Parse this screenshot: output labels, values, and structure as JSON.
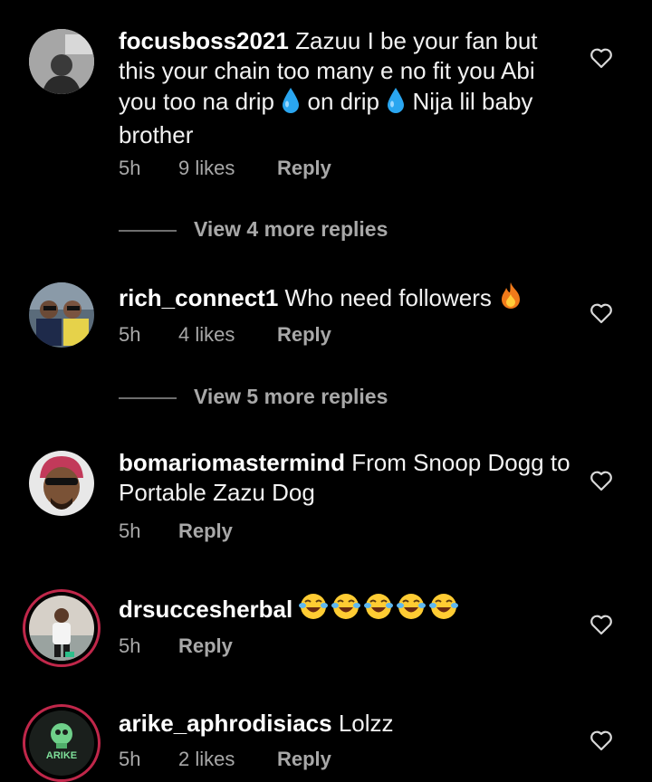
{
  "comments": [
    {
      "username": "focusboss2021",
      "text_part1": "Zazuu I be your fan but this your chain too many e no fit you Abi you too na drip",
      "text_part2": "on drip",
      "text_part3": "Nija lil baby brother",
      "emoji": "droplet-emoji",
      "time": "5h",
      "likes": "9 likes",
      "reply": "Reply",
      "view_replies": "View 4 more replies"
    },
    {
      "username": "rich_connect1",
      "text": "Who need followers",
      "emoji": "fire-emoji",
      "time": "5h",
      "likes": "4 likes",
      "reply": "Reply",
      "view_replies": "View 5 more replies"
    },
    {
      "username": "bomariomastermind",
      "text": "From Snoop Dogg to Portable Zazu Dog",
      "time": "5h",
      "reply": "Reply"
    },
    {
      "username": "drsuccesherbal",
      "emoji": "tears-of-joy-emoji",
      "emoji_count": 5,
      "time": "5h",
      "reply": "Reply"
    },
    {
      "username": "arike_aphrodisiacs",
      "text": "Lolzz",
      "time": "5h",
      "likes": "2 likes",
      "reply": "Reply"
    }
  ],
  "avatar_logo_text": "ARIKE",
  "colors": {
    "background": "#000000",
    "text": "#f2f2f2",
    "meta": "#a8a8a8",
    "story_ring": "#c0274a",
    "droplet": "#2aa6f0",
    "fire": "#f07a1a"
  }
}
